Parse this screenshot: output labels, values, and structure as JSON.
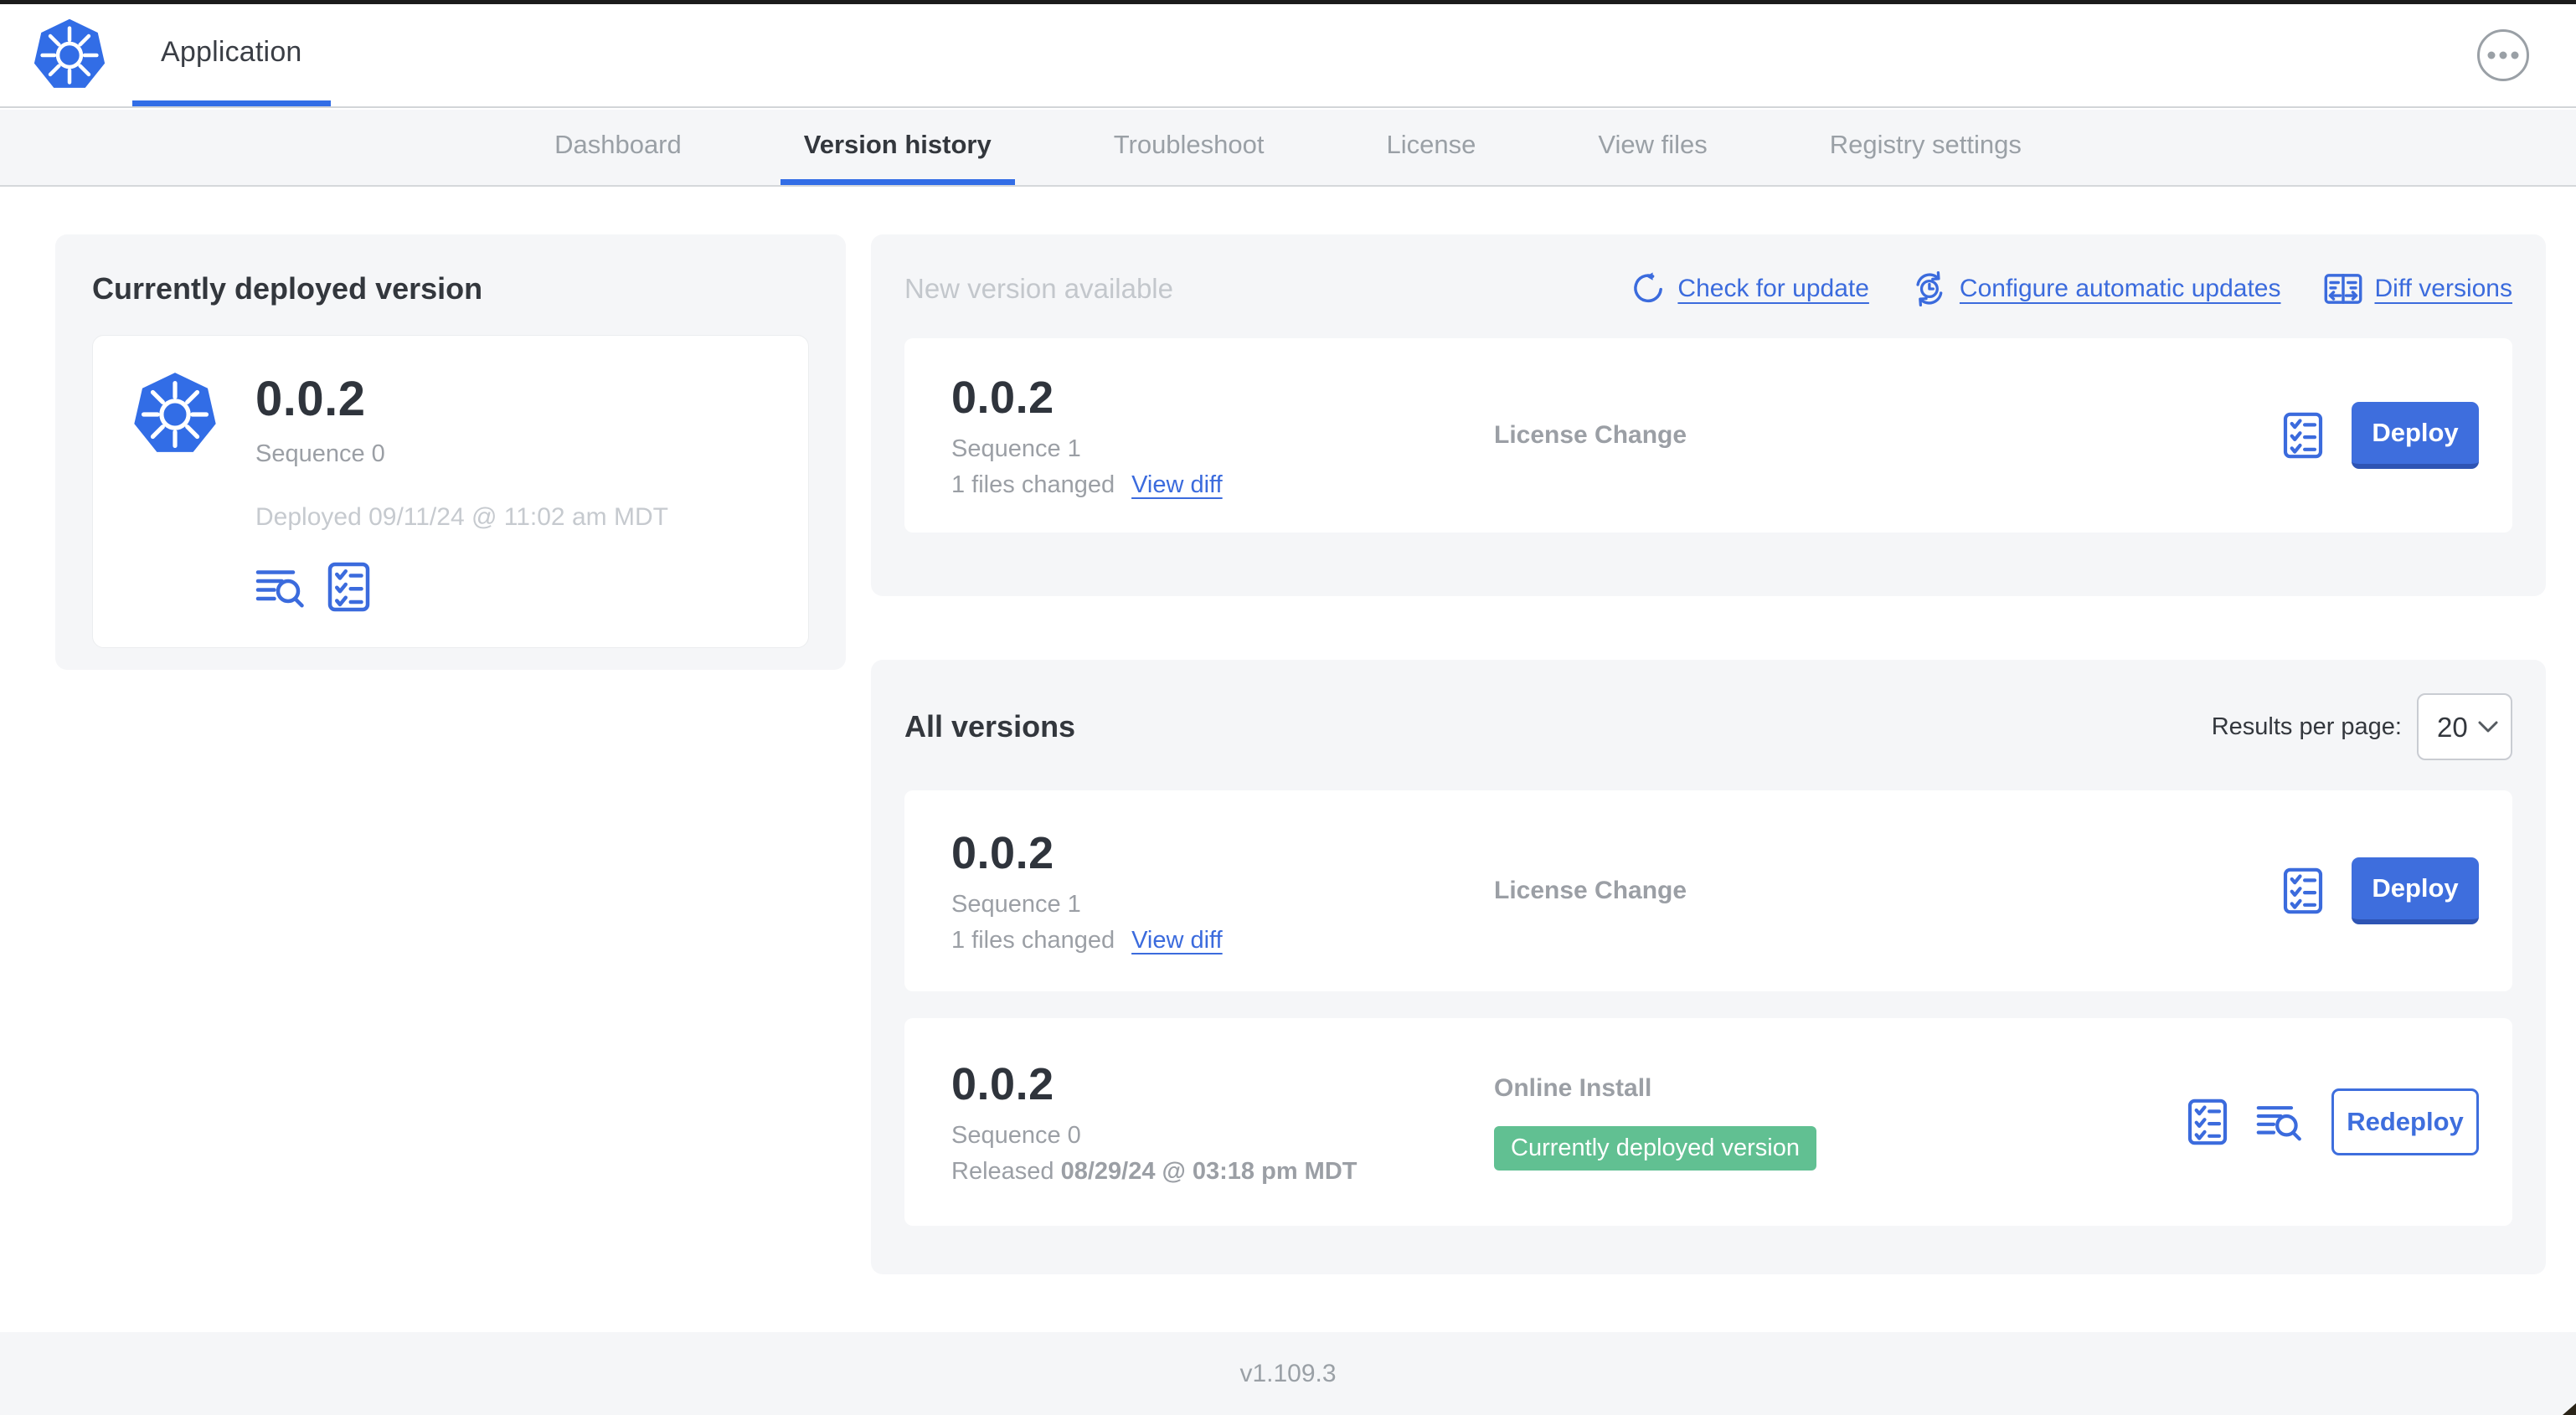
{
  "colors": {
    "accent_blue": "#3b6bdd",
    "kubernetes_blue": "#326de6",
    "badge_green": "#61c092",
    "panel_gray": "#f5f6f8",
    "text_dark": "#33373d",
    "text_gray": "#9b9fa5",
    "text_light": "#c6cacf",
    "button_blue": "#3e6edd"
  },
  "header": {
    "title": "Application",
    "logo_icon": "kubernetes-logo-icon",
    "menu_icon": "ellipsis-icon"
  },
  "nav": {
    "tabs": [
      {
        "label": "Dashboard",
        "active": false
      },
      {
        "label": "Version history",
        "active": true
      },
      {
        "label": "Troubleshoot",
        "active": false
      },
      {
        "label": "License",
        "active": false
      },
      {
        "label": "View files",
        "active": false
      },
      {
        "label": "Registry settings",
        "active": false
      }
    ]
  },
  "currently_deployed": {
    "title": "Currently deployed version",
    "version": "0.0.2",
    "sequence": "Sequence 0",
    "deployed": "Deployed 09/11/24 @ 11:02 am MDT",
    "icons": [
      "logs-icon",
      "preflight-checks-icon"
    ]
  },
  "new_version": {
    "title": "New version available",
    "links": [
      {
        "label": "Check for update",
        "icon": "refresh-icon"
      },
      {
        "label": "Configure automatic updates",
        "icon": "auto-update-clock-icon"
      },
      {
        "label": "Diff versions",
        "icon": "diff-icon"
      }
    ],
    "card": {
      "version": "0.0.2",
      "sequence": "Sequence 1",
      "files_changed": "1 files changed",
      "view_diff": "View diff",
      "source": "License Change",
      "action": "Deploy",
      "icons": [
        "preflight-checks-icon"
      ]
    }
  },
  "all_versions": {
    "title": "All versions",
    "results_per_page": {
      "label": "Results per page:",
      "value": "20"
    },
    "rows": [
      {
        "version": "0.0.2",
        "sequence": "Sequence 1",
        "files_changed": "1 files changed",
        "view_diff": "View diff",
        "source": "License Change",
        "action": "Deploy",
        "icons": [
          "preflight-checks-icon"
        ]
      },
      {
        "version": "0.0.2",
        "sequence": "Sequence 0",
        "released_prefix": "Released ",
        "released_date": "08/29/24 @ 03:18 pm MDT",
        "source": "Online Install",
        "badge": "Currently deployed version",
        "action": "Redeploy",
        "icons": [
          "preflight-checks-icon",
          "logs-icon"
        ]
      }
    ]
  },
  "footer": {
    "version": "v1.109.3"
  }
}
